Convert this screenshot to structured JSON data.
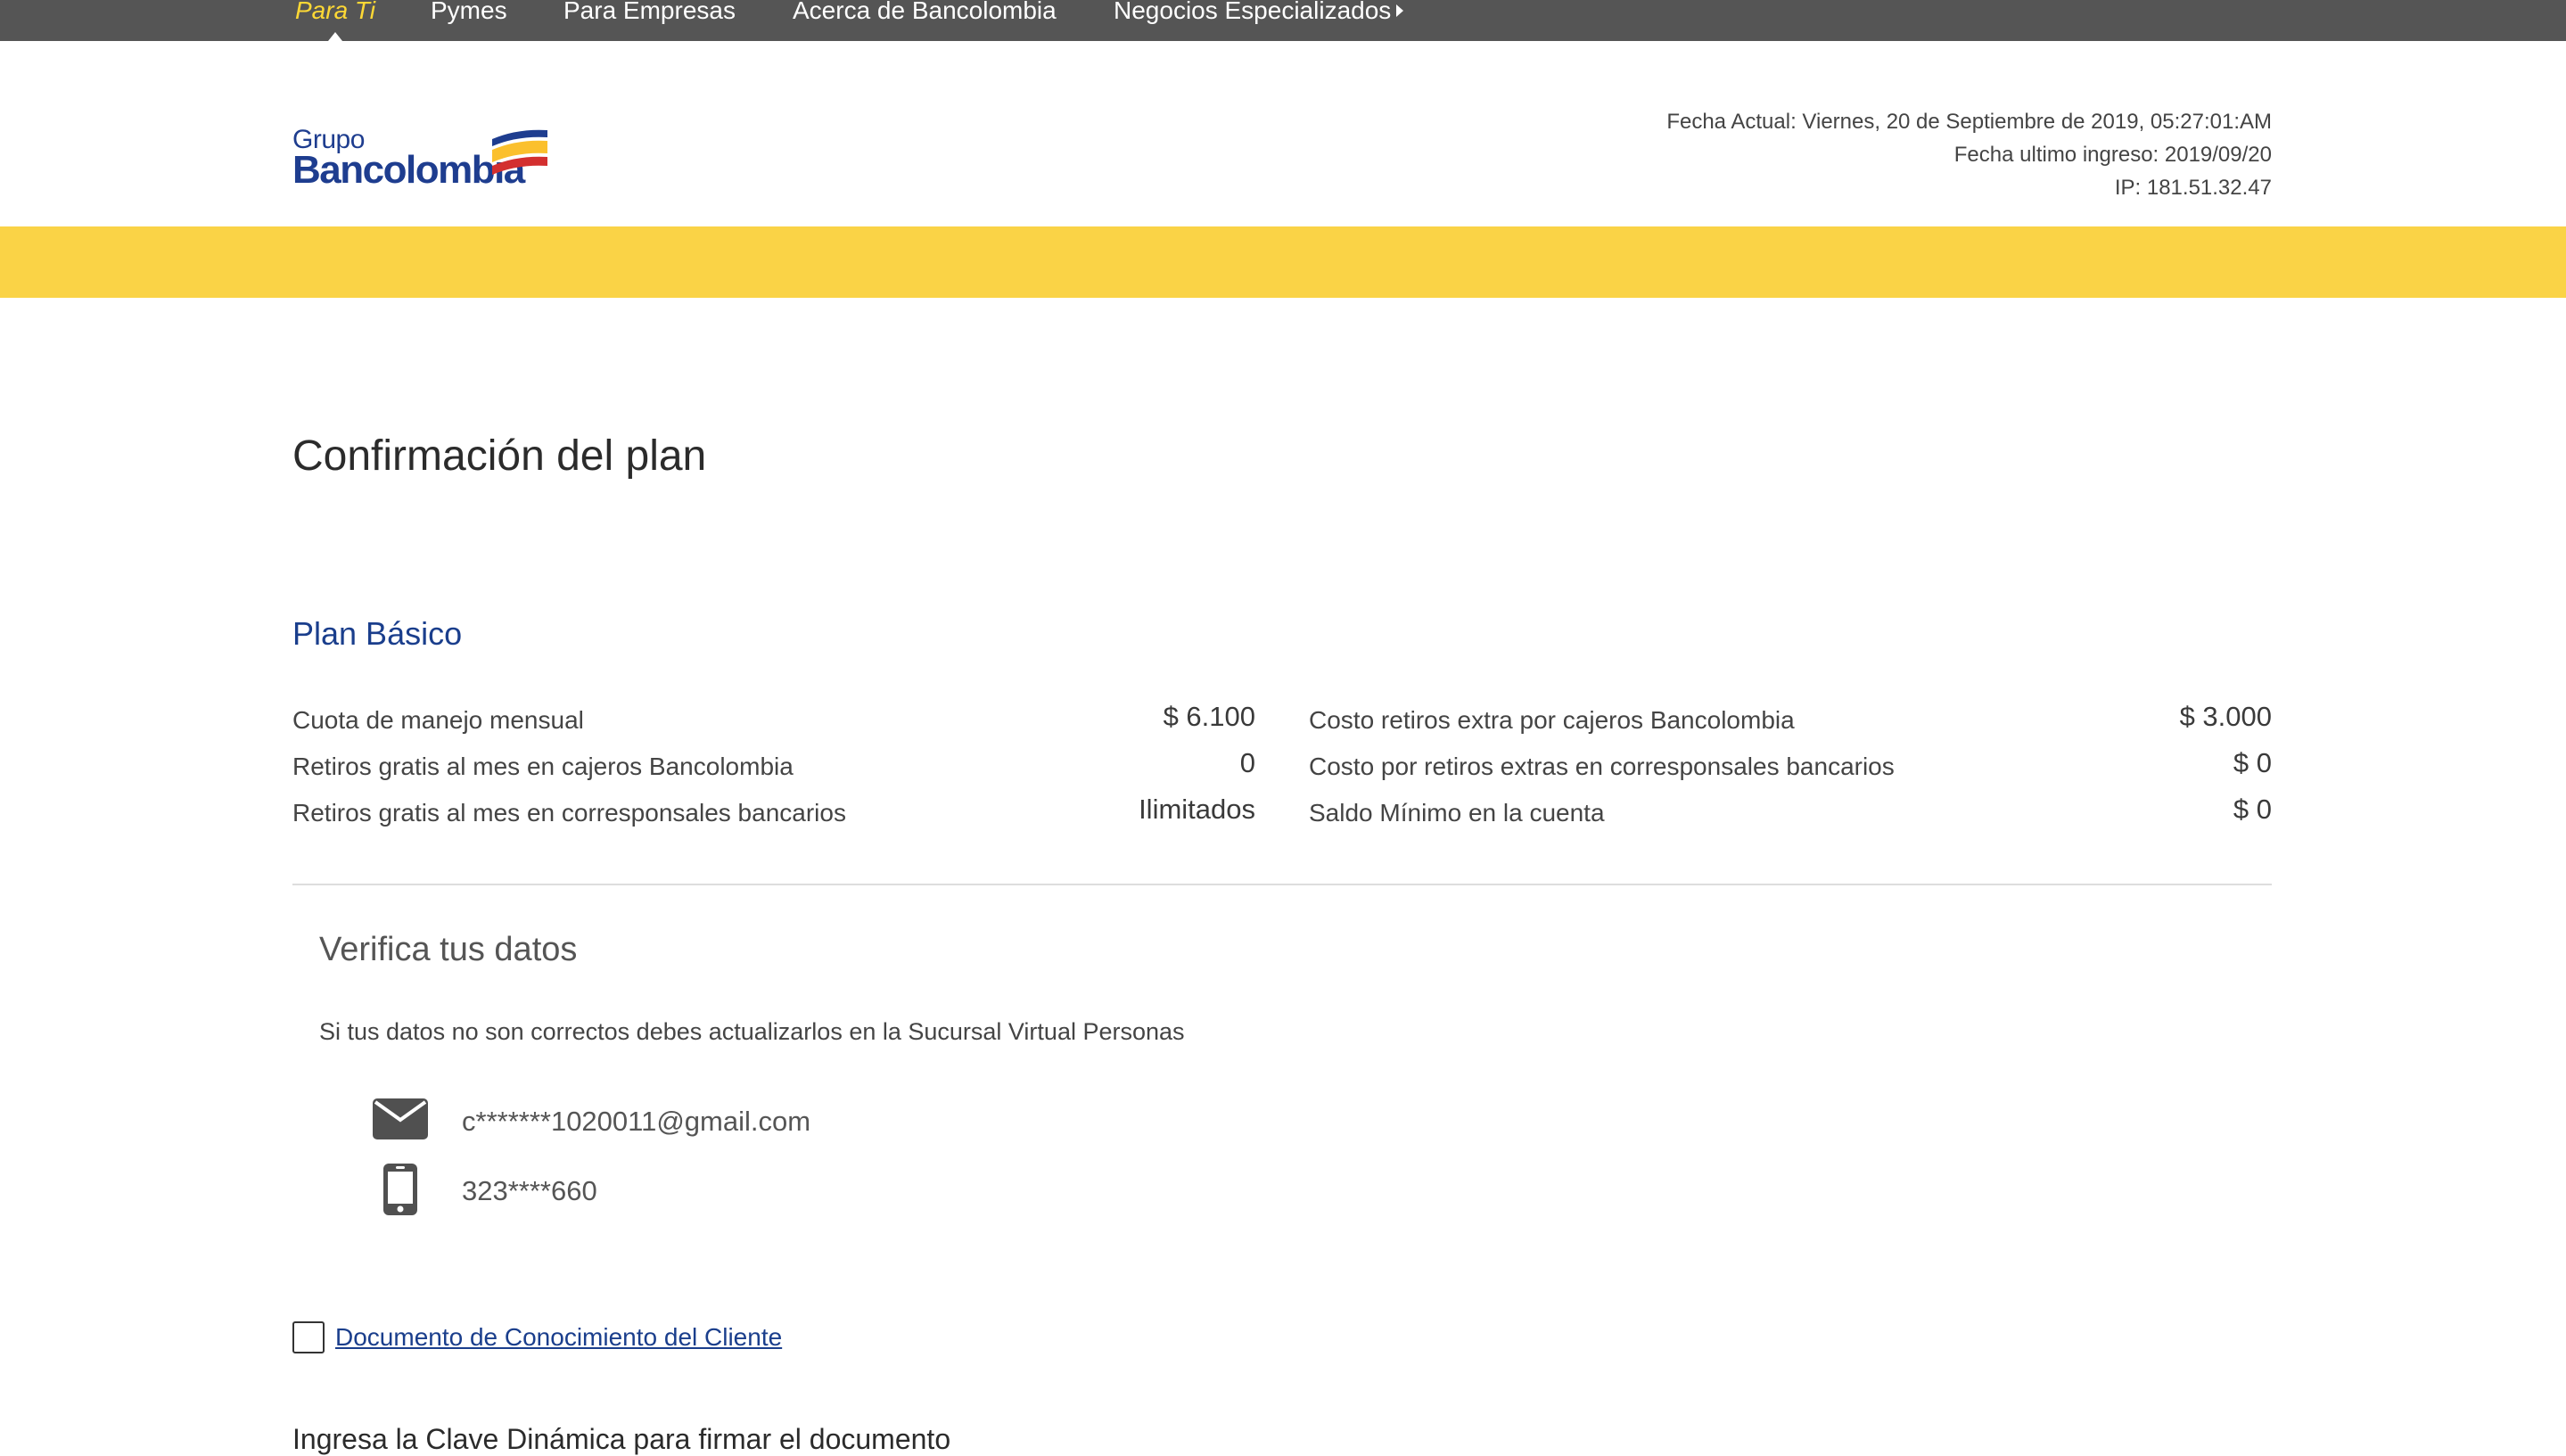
{
  "nav": {
    "items": [
      {
        "label": "Para Ti",
        "active": true
      },
      {
        "label": "Pymes",
        "active": false
      },
      {
        "label": "Para Empresas",
        "active": false
      },
      {
        "label": "Acerca de Bancolombia",
        "active": false
      },
      {
        "label": "Negocios Especializados",
        "active": false
      }
    ]
  },
  "logo": {
    "line1": "Grupo",
    "line2": "Bancolombia"
  },
  "header": {
    "fecha_actual": "Fecha Actual: Viernes, 20 de Septiembre de 2019, 05:27:01:AM",
    "fecha_ultimo": "Fecha ultimo ingreso: 2019/09/20",
    "ip": "IP: 181.51.32.47"
  },
  "page": {
    "title": "Confirmación del plan",
    "plan_name": "Plan Básico"
  },
  "plan": {
    "left": [
      {
        "label": "Cuota de manejo mensual",
        "value": "$ 6.100"
      },
      {
        "label": "Retiros gratis al mes en cajeros Bancolombia",
        "value": "0"
      },
      {
        "label": "Retiros gratis al mes en corresponsales bancarios",
        "value": "Ilimitados"
      }
    ],
    "right": [
      {
        "label": "Costo retiros extra por cajeros Bancolombia",
        "value": "$ 3.000"
      },
      {
        "label": "Costo por retiros extras en corresponsales bancarios",
        "value": "$ 0"
      },
      {
        "label": "Saldo Mínimo en la cuenta",
        "value": "$ 0"
      }
    ]
  },
  "verify": {
    "title": "Verifica tus datos",
    "description": "Si tus datos no son correctos debes actualizarlos en la Sucursal Virtual Personas",
    "email": "c*******1020011@gmail.com",
    "phone": "323****660",
    "email_icon": "envelope-icon",
    "phone_icon": "mobile-phone-icon"
  },
  "document": {
    "checked": false,
    "link_label": "Documento de Conocimiento del Cliente"
  },
  "signature": {
    "instruction": "Ingresa la Clave Dinámica para firmar el documento"
  },
  "colors": {
    "nav_bg": "#555555",
    "nav_active": "#fdd835",
    "brand_blue": "#1a3e8c",
    "yellow_band": "#fad346"
  }
}
